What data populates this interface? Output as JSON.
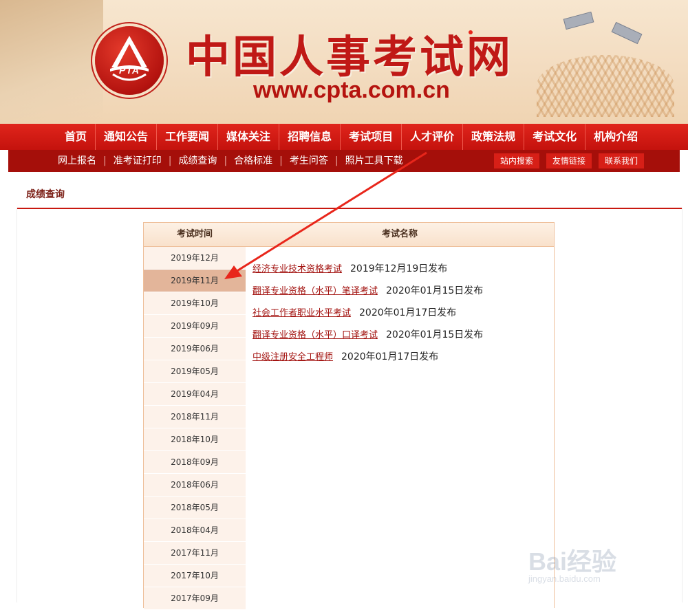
{
  "header": {
    "logo_text": "PTA",
    "site_title": "中国人事考试网",
    "site_url": "www.cpta.com.cn"
  },
  "nav": {
    "items": [
      "首页",
      "通知公告",
      "工作要闻",
      "媒体关注",
      "招聘信息",
      "考试项目",
      "人才评价",
      "政策法规",
      "考试文化",
      "机构介绍"
    ]
  },
  "subnav": {
    "items": [
      "网上报名",
      "准考证打印",
      "成绩查询",
      "合格标准",
      "考生问答",
      "照片工具下载"
    ],
    "tools": [
      "站内搜索",
      "友情链接",
      "联系我们"
    ]
  },
  "page": {
    "section_title": "成绩查询",
    "time_header": "考试时间",
    "name_header": "考试名称"
  },
  "exam_times": [
    {
      "label": "2019年12月",
      "active": false
    },
    {
      "label": "2019年11月",
      "active": true
    },
    {
      "label": "2019年10月",
      "active": false
    },
    {
      "label": "2019年09月",
      "active": false
    },
    {
      "label": "2019年06月",
      "active": false
    },
    {
      "label": "2019年05月",
      "active": false
    },
    {
      "label": "2019年04月",
      "active": false
    },
    {
      "label": "2018年11月",
      "active": false
    },
    {
      "label": "2018年10月",
      "active": false
    },
    {
      "label": "2018年09月",
      "active": false
    },
    {
      "label": "2018年06月",
      "active": false
    },
    {
      "label": "2018年05月",
      "active": false
    },
    {
      "label": "2018年04月",
      "active": false
    },
    {
      "label": "2017年11月",
      "active": false
    },
    {
      "label": "2017年10月",
      "active": false
    },
    {
      "label": "2017年09月",
      "active": false
    }
  ],
  "results": [
    {
      "name": "经济专业技术资格考试",
      "date": "2019年12月19日发布"
    },
    {
      "name": "翻译专业资格（水平）笔译考试",
      "date": "2020年01月15日发布"
    },
    {
      "name": "社会工作者职业水平考试",
      "date": "2020年01月17日发布"
    },
    {
      "name": "翻译专业资格（水平）口译考试",
      "date": "2020年01月15日发布"
    },
    {
      "name": "中级注册安全工程师",
      "date": "2020年01月17日发布"
    }
  ],
  "watermark": {
    "logo": "Bai经验",
    "sub": "jingyan.baidu.com"
  },
  "colors": {
    "brand_red": "#c01916",
    "nav_red": "#d81e16",
    "subnav_red": "#a50f0a",
    "active_row": "#e3b59a",
    "annotation_arrow": "#e8261b"
  }
}
